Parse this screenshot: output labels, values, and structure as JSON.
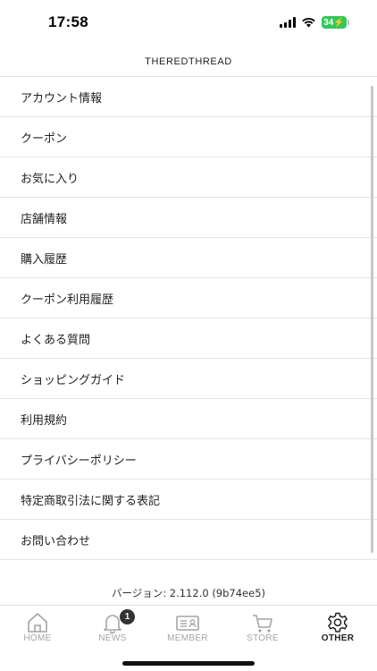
{
  "status": {
    "time": "17:58",
    "battery": "34"
  },
  "header": {
    "logo": "THEREDTHREAD"
  },
  "menu": {
    "items": [
      {
        "label": "アカウント情報"
      },
      {
        "label": "クーポン"
      },
      {
        "label": "お気に入り"
      },
      {
        "label": "店舗情報"
      },
      {
        "label": "購入履歴"
      },
      {
        "label": "クーポン利用履歴"
      },
      {
        "label": "よくある質問"
      },
      {
        "label": "ショッピングガイド"
      },
      {
        "label": "利用規約"
      },
      {
        "label": "プライバシーポリシー"
      },
      {
        "label": "特定商取引法に関する表記"
      },
      {
        "label": "お問い合わせ"
      }
    ]
  },
  "version": "バージョン: 2.112.0 (9b74ee5)",
  "tabbar": {
    "tabs": [
      {
        "label": "HOME",
        "icon": "home-icon"
      },
      {
        "label": "NEWS",
        "icon": "bell-icon",
        "badge": "1"
      },
      {
        "label": "MEMBER",
        "icon": "member-card-icon"
      },
      {
        "label": "STORE",
        "icon": "cart-icon"
      },
      {
        "label": "OTHER",
        "icon": "gear-icon",
        "active": true
      }
    ]
  },
  "colors": {
    "battery": "#34c759",
    "inactive_tab": "#a4a4a4",
    "active_tab": "#222222"
  }
}
